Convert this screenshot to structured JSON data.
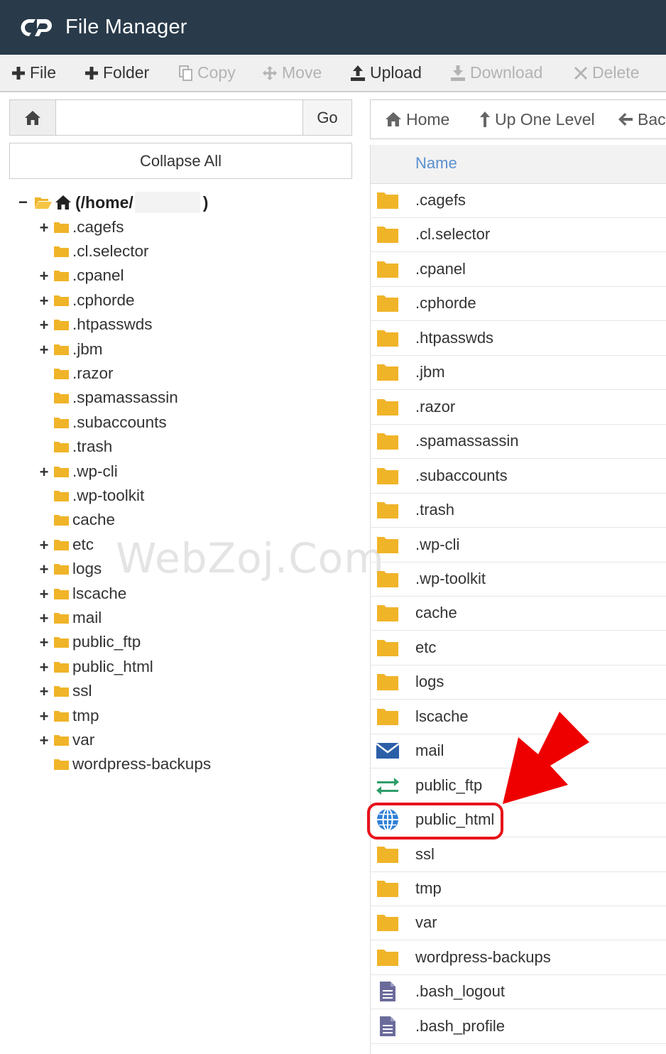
{
  "header": {
    "title": "File Manager"
  },
  "toolbar": {
    "file": "File",
    "folder": "Folder",
    "copy": "Copy",
    "move": "Move",
    "upload": "Upload",
    "download": "Download",
    "delete": "Delete"
  },
  "path_bar": {
    "value": "",
    "go_label": "Go"
  },
  "collapse_label": "Collapse All",
  "tree": {
    "root_prefix": "(/home/",
    "root_suffix": ")",
    "items": [
      {
        "label": ".cagefs",
        "expandable": true
      },
      {
        "label": ".cl.selector",
        "expandable": false
      },
      {
        "label": ".cpanel",
        "expandable": true
      },
      {
        "label": ".cphorde",
        "expandable": true
      },
      {
        "label": ".htpasswds",
        "expandable": true
      },
      {
        "label": ".jbm",
        "expandable": true
      },
      {
        "label": ".razor",
        "expandable": false
      },
      {
        "label": ".spamassassin",
        "expandable": false
      },
      {
        "label": ".subaccounts",
        "expandable": false
      },
      {
        "label": ".trash",
        "expandable": false
      },
      {
        "label": ".wp-cli",
        "expandable": true
      },
      {
        "label": ".wp-toolkit",
        "expandable": false
      },
      {
        "label": "cache",
        "expandable": false
      },
      {
        "label": "etc",
        "expandable": true
      },
      {
        "label": "logs",
        "expandable": true
      },
      {
        "label": "lscache",
        "expandable": true
      },
      {
        "label": "mail",
        "expandable": true
      },
      {
        "label": "public_ftp",
        "expandable": true
      },
      {
        "label": "public_html",
        "expandable": true
      },
      {
        "label": "ssl",
        "expandable": true
      },
      {
        "label": "tmp",
        "expandable": true
      },
      {
        "label": "var",
        "expandable": true
      },
      {
        "label": "wordpress-backups",
        "expandable": false
      }
    ]
  },
  "watermark": "WebZoj.Com",
  "nav": {
    "home": "Home",
    "up_one_level": "Up One Level",
    "back": "Back"
  },
  "table": {
    "name_header": "Name",
    "rows": [
      {
        "name": ".cagefs",
        "icon": "folder-icon"
      },
      {
        "name": ".cl.selector",
        "icon": "folder-icon"
      },
      {
        "name": ".cpanel",
        "icon": "folder-icon"
      },
      {
        "name": ".cphorde",
        "icon": "folder-icon"
      },
      {
        "name": ".htpasswds",
        "icon": "folder-icon"
      },
      {
        "name": ".jbm",
        "icon": "folder-icon"
      },
      {
        "name": ".razor",
        "icon": "folder-icon"
      },
      {
        "name": ".spamassassin",
        "icon": "folder-icon"
      },
      {
        "name": ".subaccounts",
        "icon": "folder-icon"
      },
      {
        "name": ".trash",
        "icon": "folder-icon"
      },
      {
        "name": ".wp-cli",
        "icon": "folder-icon"
      },
      {
        "name": ".wp-toolkit",
        "icon": "folder-icon"
      },
      {
        "name": "cache",
        "icon": "folder-icon"
      },
      {
        "name": "etc",
        "icon": "folder-icon"
      },
      {
        "name": "logs",
        "icon": "folder-icon"
      },
      {
        "name": "lscache",
        "icon": "folder-icon"
      },
      {
        "name": "mail",
        "icon": "envelope-icon"
      },
      {
        "name": "public_ftp",
        "icon": "exchange-arrows-icon"
      },
      {
        "name": "public_html",
        "icon": "globe-icon"
      },
      {
        "name": "ssl",
        "icon": "folder-icon"
      },
      {
        "name": "tmp",
        "icon": "folder-icon"
      },
      {
        "name": "var",
        "icon": "folder-icon"
      },
      {
        "name": "wordpress-backups",
        "icon": "folder-icon"
      },
      {
        "name": ".bash_logout",
        "icon": "text-file-icon"
      },
      {
        "name": ".bash_profile",
        "icon": "text-file-icon"
      }
    ]
  },
  "colors": {
    "header_bg": "#293a4a",
    "folder": "#f0b429",
    "link": "#5a8fcf",
    "highlight": "#e8131a"
  }
}
